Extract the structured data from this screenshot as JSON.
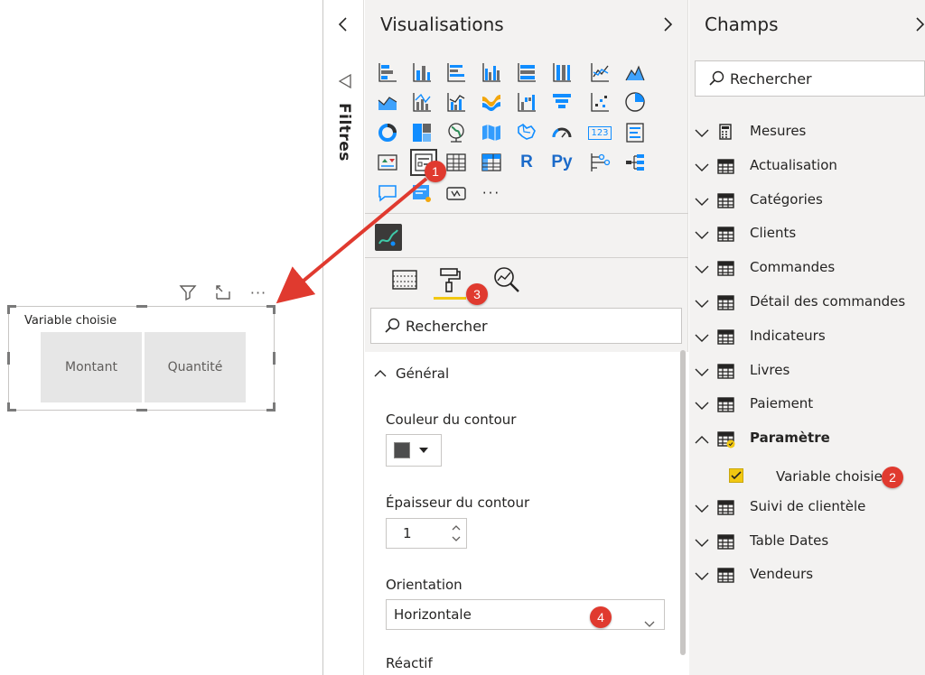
{
  "canvas": {
    "slicer": {
      "title": "Variable choisie",
      "items": [
        "Montant",
        "Quantité"
      ]
    },
    "visual_header_icons": [
      "filter-icon",
      "focus-mode-icon",
      "more-options-icon"
    ],
    "visual_header_more": "···"
  },
  "filters_pane": {
    "title": "Filtres"
  },
  "visualisations_pane": {
    "title": "Visualisations",
    "more_visuals": "···",
    "r_label": "R",
    "py_label": "Py",
    "card_label": "123",
    "search_placeholder": "Rechercher",
    "format": {
      "section": "Général",
      "border_color_label": "Couleur du contour",
      "border_color": "#4d4d4d",
      "border_thickness_label": "Épaisseur du contour",
      "border_thickness_value": "1",
      "orientation_label": "Orientation",
      "orientation_value": "Horizontale",
      "responsive_label": "Réactif"
    }
  },
  "fields_pane": {
    "title": "Champs",
    "search_placeholder": "Rechercher",
    "tables": [
      {
        "label": "Mesures",
        "icon": "calculator-icon",
        "expanded": false
      },
      {
        "label": "Actualisation",
        "icon": "table-icon",
        "expanded": false
      },
      {
        "label": "Catégories",
        "icon": "table-icon",
        "expanded": false
      },
      {
        "label": "Clients",
        "icon": "table-icon",
        "expanded": false
      },
      {
        "label": "Commandes",
        "icon": "table-icon",
        "expanded": false
      },
      {
        "label": "Détail des commandes",
        "icon": "table-icon",
        "expanded": false
      },
      {
        "label": "Indicateurs",
        "icon": "table-icon",
        "expanded": false
      },
      {
        "label": "Livres",
        "icon": "table-icon",
        "expanded": false
      },
      {
        "label": "Paiement",
        "icon": "table-icon",
        "expanded": false
      },
      {
        "label": "Paramètre",
        "icon": "table-icon",
        "expanded": true
      },
      {
        "label": "Suivi de clientèle",
        "icon": "table-icon",
        "expanded": false
      },
      {
        "label": "Table Dates",
        "icon": "table-icon",
        "expanded": false
      },
      {
        "label": "Vendeurs",
        "icon": "table-icon",
        "expanded": false
      }
    ],
    "selected_field": "Variable choisie"
  },
  "callouts": [
    "1",
    "2",
    "3",
    "4"
  ],
  "colors": {
    "accent": "#f2c811",
    "callout": "#e03a2f",
    "pane_bg": "#f3f2f1"
  }
}
